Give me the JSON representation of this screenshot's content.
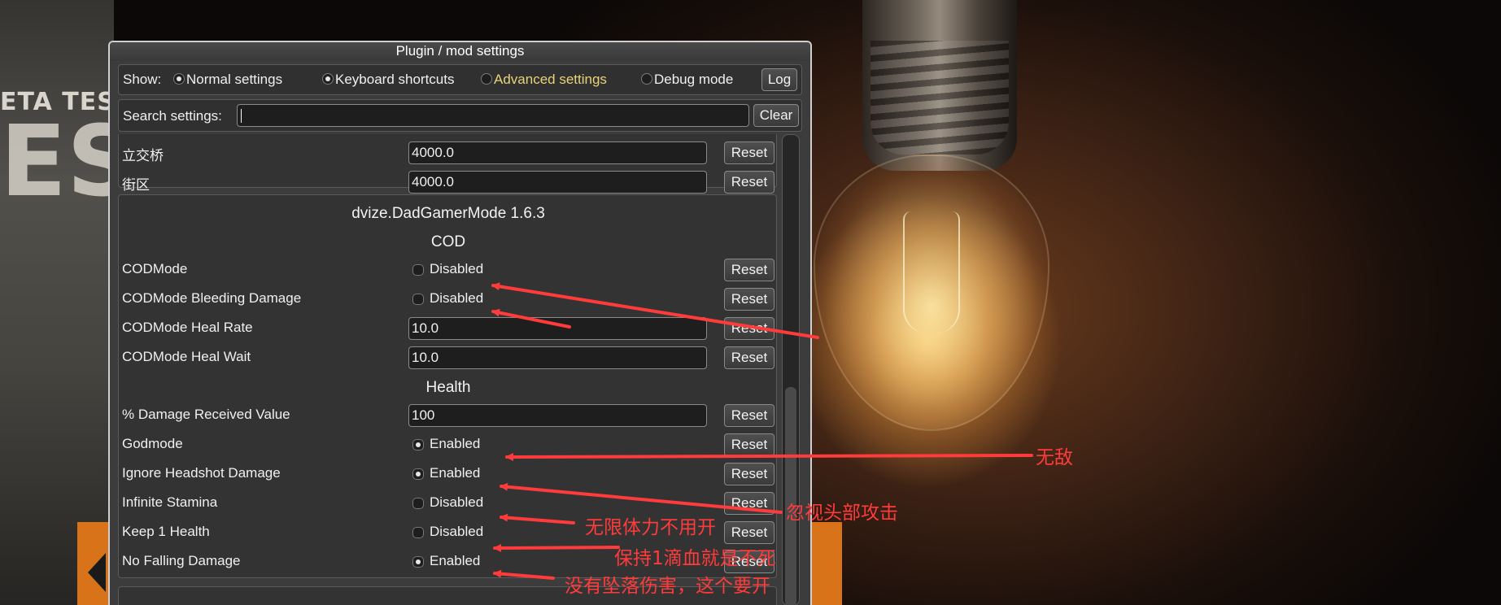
{
  "window": {
    "title": "Plugin / mod settings"
  },
  "show_bar": {
    "label": "Show:",
    "options": [
      {
        "label": "Normal settings",
        "selected": true
      },
      {
        "label": "Keyboard shortcuts",
        "selected": true
      },
      {
        "label": "Advanced settings",
        "selected": false
      },
      {
        "label": "Debug mode",
        "selected": false
      }
    ],
    "log_button": "Log"
  },
  "search": {
    "label": "Search settings:",
    "value": "",
    "clear_button": "Clear"
  },
  "prev_group": {
    "rows": [
      {
        "name": "立交桥",
        "value": "4000.0",
        "reset": "Reset"
      },
      {
        "name": "街区",
        "value": "4000.0",
        "reset": "Reset"
      }
    ]
  },
  "group": {
    "title": "dvize.DadGamerMode 1.6.3",
    "sections": [
      {
        "title": "COD",
        "rows": [
          {
            "name": "CODMode",
            "type": "toggle",
            "on": false,
            "state": "Disabled",
            "reset": "Reset"
          },
          {
            "name": "CODMode Bleeding Damage",
            "type": "toggle",
            "on": false,
            "state": "Disabled",
            "reset": "Reset"
          },
          {
            "name": "CODMode Heal Rate",
            "type": "text",
            "value": "10.0",
            "reset": "Reset"
          },
          {
            "name": "CODMode Heal Wait",
            "type": "text",
            "value": "10.0",
            "reset": "Reset"
          }
        ]
      },
      {
        "title": "Health",
        "rows": [
          {
            "name": "% Damage Received Value",
            "type": "text",
            "value": "100",
            "reset": "Reset"
          },
          {
            "name": "Godmode",
            "type": "toggle",
            "on": true,
            "state": "Enabled",
            "reset": "Reset"
          },
          {
            "name": "Ignore Headshot Damage",
            "type": "toggle",
            "on": true,
            "state": "Enabled",
            "reset": "Reset"
          },
          {
            "name": "Infinite Stamina",
            "type": "toggle",
            "on": false,
            "state": "Disabled",
            "reset": "Reset"
          },
          {
            "name": "Keep 1 Health",
            "type": "toggle",
            "on": false,
            "state": "Disabled",
            "reset": "Reset"
          },
          {
            "name": "No Falling Damage",
            "type": "toggle",
            "on": true,
            "state": "Enabled",
            "reset": "Reset"
          }
        ]
      }
    ]
  },
  "background": {
    "text": "ETA TEST",
    "big_letters": "ES"
  },
  "annotations": {
    "godmode": "无敌",
    "headshot": "忽视头部攻击",
    "stamina": "无限体力不用开",
    "keep1": "保持1滴血就是不死",
    "falling": "没有坠落伤害，这个要开"
  },
  "colors": {
    "annotation": "#ff3b3b",
    "advanced_label": "#e8d27a",
    "window_bg": "#3c3c3c"
  }
}
